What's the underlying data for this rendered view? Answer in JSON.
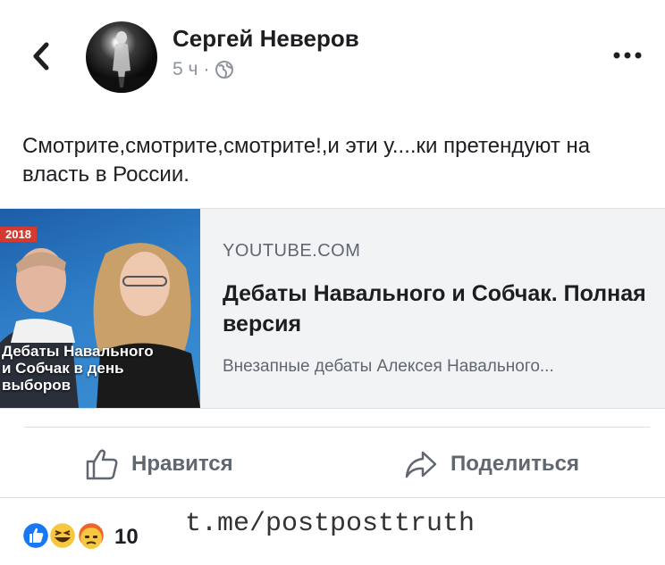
{
  "post": {
    "author": "Сергей Неверов",
    "time": "5 ч",
    "separator": "·",
    "text": "Смотрите,смотрите,смотрите!,и эти у....ки претендуют на власть в России."
  },
  "link_card": {
    "thumbnail_badge": "2018",
    "thumbnail_caption_lines": [
      "Дебаты Навального",
      "и Собчак в день",
      "выборов"
    ],
    "domain": "YOUTUBE.COM",
    "title": "Дебаты Навального и Собчак. Полная версия",
    "description": "Внезапные дебаты Алексея Навального..."
  },
  "actions": {
    "like_label": "Нравится",
    "share_label": "Поделиться"
  },
  "reactions": {
    "icons": [
      "like-icon",
      "haha-icon",
      "angry-icon"
    ],
    "count": "10"
  },
  "watermark": "t.me/postposttruth",
  "colors": {
    "facebook_blue": "#1877f2",
    "reaction_yellow": "#f7c740",
    "reaction_orange": "#f0642a",
    "secondary_text": "#606770"
  }
}
